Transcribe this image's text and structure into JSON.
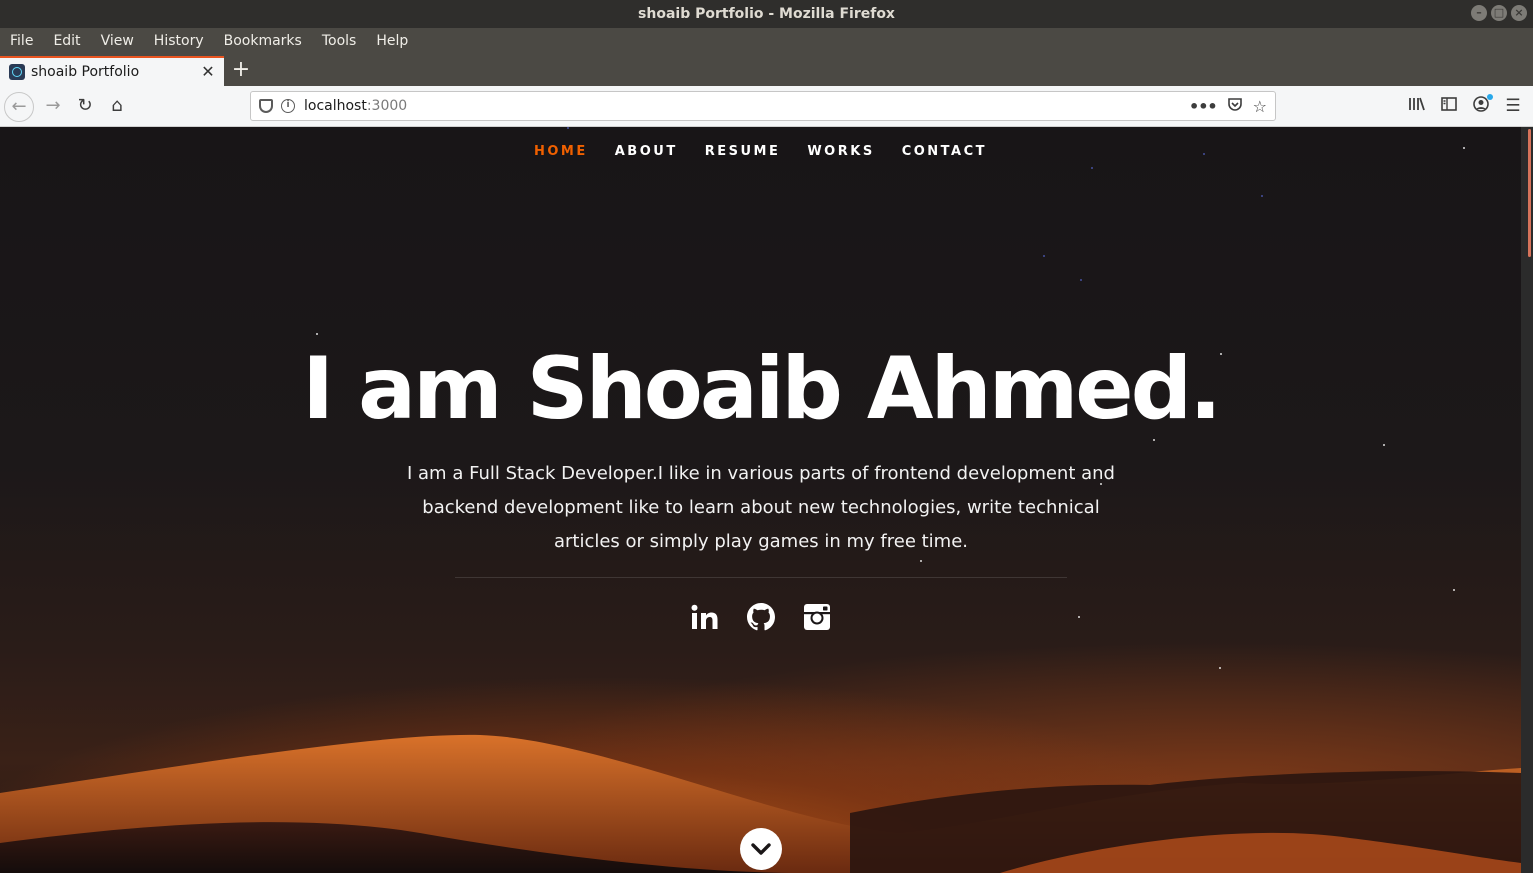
{
  "window": {
    "title": "shoaib Portfolio - Mozilla Firefox",
    "controls": [
      "minimize-icon",
      "maximize-icon",
      "close-icon"
    ]
  },
  "menubar": {
    "items": [
      {
        "label": "File"
      },
      {
        "label": "Edit"
      },
      {
        "label": "View"
      },
      {
        "label": "History"
      },
      {
        "label": "Bookmarks"
      },
      {
        "label": "Tools"
      },
      {
        "label": "Help"
      }
    ]
  },
  "tabs": [
    {
      "title": "shoaib Portfolio",
      "active": true,
      "icon": "react-favicon-icon"
    }
  ],
  "urlbar": {
    "host": "localhost",
    "port": ":3000"
  },
  "site": {
    "nav": [
      {
        "label": "HOME",
        "active": true
      },
      {
        "label": "ABOUT",
        "active": false
      },
      {
        "label": "RESUME",
        "active": false
      },
      {
        "label": "WORKS",
        "active": false
      },
      {
        "label": "CONTACT",
        "active": false
      }
    ],
    "accent": "#f06000",
    "hero": {
      "title": "I am Shoaib Ahmed.",
      "description": "I am a Full Stack Developer.I like in various parts of frontend development and backend development like to learn about new technologies, write technical articles or simply play games in my free time."
    },
    "socials": [
      "linkedin-icon",
      "github-icon",
      "instagram-icon"
    ],
    "scroll_down_icon": "chevron-down-icon"
  }
}
